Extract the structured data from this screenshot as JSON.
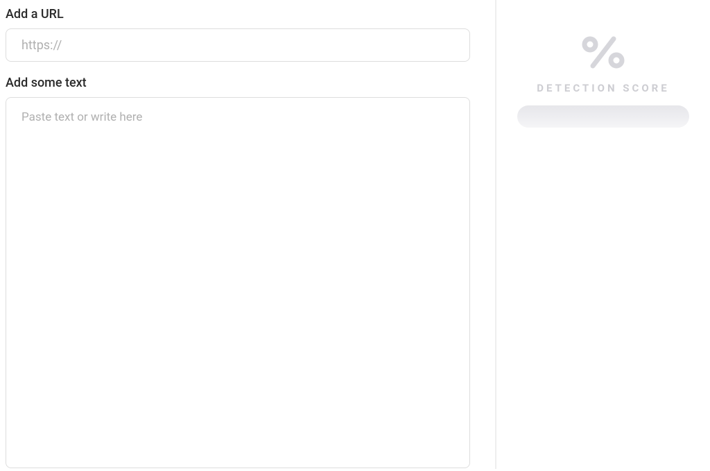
{
  "main": {
    "url_label": "Add a URL",
    "url_placeholder": "https://",
    "text_label": "Add some text",
    "text_placeholder": "Paste text or write here"
  },
  "side": {
    "score_title": "DETECTION SCORE"
  }
}
